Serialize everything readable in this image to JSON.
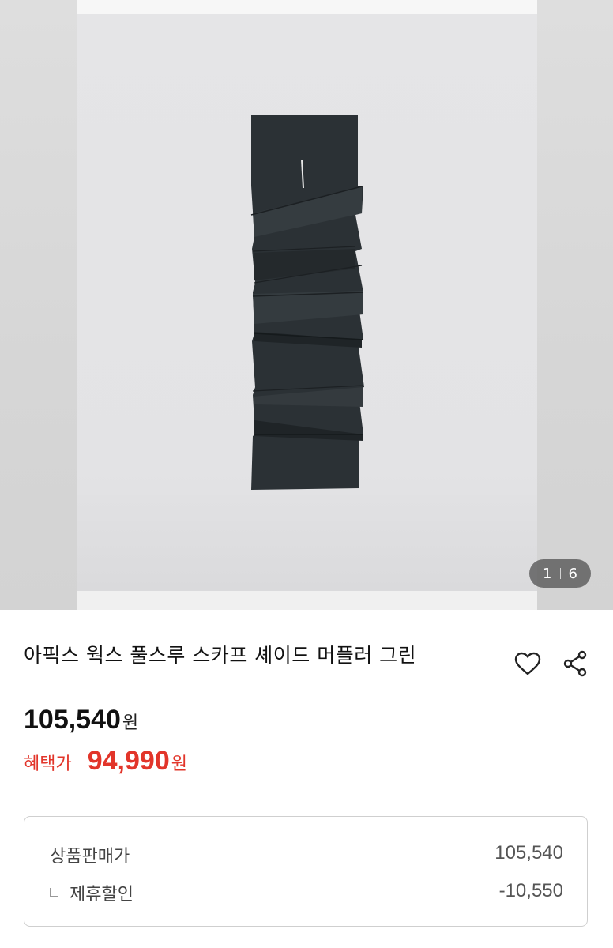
{
  "gallery": {
    "current_page": "1",
    "total_pages": "6",
    "image_icon": "scarf-product-photo"
  },
  "product": {
    "title": "아픽스 웍스 풀스루 스카프 셰이드 머플러 그린",
    "original_price": "105,540",
    "original_unit": "원",
    "sale_label": "혜택가",
    "sale_price": "94,990",
    "sale_unit": "원",
    "sale_color": "#e2352a"
  },
  "actions": {
    "like_icon": "heart-icon",
    "share_icon": "share-icon"
  },
  "breakdown": {
    "rows": [
      {
        "label": "상품판매가",
        "value": "105,540"
      },
      {
        "label": "제휴할인",
        "value": "-10,550"
      }
    ]
  }
}
